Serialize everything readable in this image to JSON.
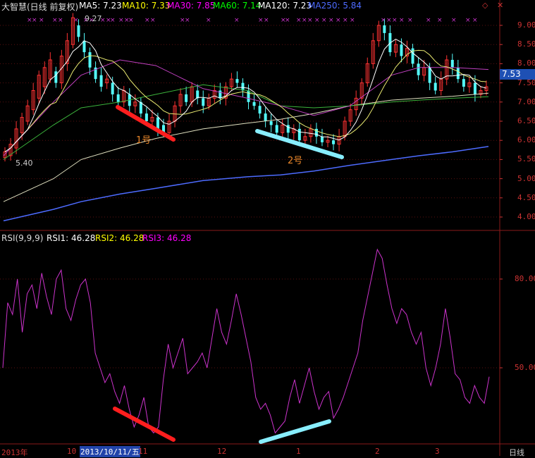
{
  "header": {
    "stock_name": "大智慧(日线 前复权)",
    "ma5": "MA5: 7.23",
    "ma10": "MA10: 7.33",
    "ma30": "MA30: 7.85",
    "ma60": "MA60: 7.14",
    "ma120": "MA120: 7.23",
    "ma250": "MA250: 5.84",
    "diamond": "◇",
    "close": "✕"
  },
  "rsi_header": {
    "name": "RSI(9,9,9)",
    "rsi1": "RSI1: 46.28",
    "rsi2": "RSI2: 46.28",
    "rsi3": "RSI3: 46.28"
  },
  "annotations": {
    "label1": "1号",
    "label2": "2号"
  },
  "price_marks": {
    "high": "9.27",
    "low": "5.40",
    "current": "7.53"
  },
  "x_axis": {
    "labels": [
      "2013年",
      "10",
      "2013/10/11/五",
      "11",
      "12",
      "1",
      "2",
      "3"
    ],
    "period": "日线"
  },
  "colors": {
    "ma5": "#ffffff",
    "ma10": "#ffff00",
    "ma30": "#ff00ff",
    "ma60": "#00ff00",
    "ma120": "#ffffff",
    "ma250": "#4d6bff",
    "rsi": "#cc33cc",
    "up": "#ff3232",
    "down": "#54fcfc",
    "divergence1": "#ff1e1e",
    "divergence2": "#88eeff"
  },
  "chart_data": [
    {
      "type": "line",
      "title": "大智慧(日线 前复权)",
      "y_ticks": [
        "9.00",
        "8.50",
        "8.00",
        "7.50",
        "7.00",
        "6.50",
        "6.00",
        "5.50",
        "5.00",
        "4.50",
        "4.00"
      ],
      "ylim": [
        3.8,
        9.5
      ],
      "x": [
        0,
        18,
        28,
        42,
        55,
        72,
        88,
        100,
        112,
        125,
        140,
        150,
        162,
        175
      ],
      "series": [
        {
          "name": "MA250",
          "values": [
            3.9,
            4.2,
            4.4,
            4.6,
            4.75,
            4.95,
            5.05,
            5.1,
            5.2,
            5.35,
            5.5,
            5.6,
            5.7,
            5.84
          ]
        },
        {
          "name": "MA120",
          "values": [
            4.4,
            5.0,
            5.5,
            5.8,
            6.05,
            6.3,
            6.45,
            6.55,
            6.7,
            6.9,
            7.05,
            7.1,
            7.15,
            7.23
          ]
        },
        {
          "name": "MA60",
          "values": [
            5.5,
            6.4,
            6.85,
            7.0,
            7.2,
            7.45,
            7.3,
            6.9,
            6.85,
            6.9,
            7.0,
            7.05,
            7.1,
            7.14
          ]
        },
        {
          "name": "MA30",
          "values": [
            5.6,
            7.0,
            7.7,
            8.1,
            7.95,
            7.35,
            7.1,
            6.9,
            6.65,
            6.9,
            7.7,
            7.9,
            7.9,
            7.85
          ]
        }
      ]
    },
    {
      "type": "line",
      "title": "RSI(9,9,9)",
      "y_ticks": [
        "80.00",
        "50.00"
      ],
      "ylim": [
        25,
        95
      ],
      "series": [
        {
          "name": "RSI1",
          "values": [
            50,
            72,
            68,
            80,
            62,
            75,
            78,
            70,
            82,
            74,
            68,
            80,
            83,
            70,
            66,
            73,
            78,
            80,
            72,
            55,
            50,
            45,
            48,
            42,
            38,
            44,
            36,
            30,
            34,
            40,
            30,
            28,
            30,
            46,
            58,
            50,
            55,
            60,
            48,
            50,
            52,
            55,
            50,
            60,
            70,
            62,
            58,
            66,
            75,
            68,
            60,
            52,
            40,
            36,
            38,
            34,
            28,
            30,
            32,
            40,
            46,
            38,
            44,
            50,
            42,
            36,
            40,
            42,
            33,
            36,
            40,
            45,
            50,
            55,
            66,
            74,
            82,
            90,
            87,
            78,
            70,
            65,
            70,
            68,
            62,
            58,
            62,
            50,
            44,
            50,
            58,
            70,
            60,
            48,
            46,
            40,
            38,
            44,
            40,
            38,
            47
          ]
        }
      ]
    }
  ]
}
